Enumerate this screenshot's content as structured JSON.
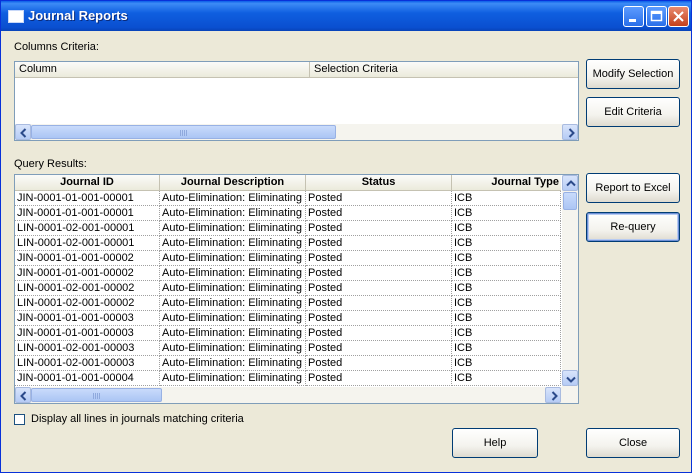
{
  "window": {
    "title": "Journal Reports"
  },
  "columns_criteria": {
    "label": "Columns Criteria:",
    "headers": [
      "Column",
      "Selection Criteria"
    ]
  },
  "query_results": {
    "label": "Query Results:",
    "headers": [
      "Journal ID",
      "Journal Description",
      "Status",
      "Journal Type"
    ],
    "rows": [
      [
        "JIN-0001-01-001-00001",
        "Auto-Elimination: Eliminating Tr",
        "Posted",
        "ICB"
      ],
      [
        "JIN-0001-01-001-00001",
        "Auto-Elimination: Eliminating Tr",
        "Posted",
        "ICB"
      ],
      [
        "LIN-0001-02-001-00001",
        "Auto-Elimination: Eliminating Tr",
        "Posted",
        "ICB"
      ],
      [
        "LIN-0001-02-001-00001",
        "Auto-Elimination: Eliminating Tr",
        "Posted",
        "ICB"
      ],
      [
        "JIN-0001-01-001-00002",
        "Auto-Elimination: Eliminating Tr",
        "Posted",
        "ICB"
      ],
      [
        "JIN-0001-01-001-00002",
        "Auto-Elimination: Eliminating Tr",
        "Posted",
        "ICB"
      ],
      [
        "LIN-0001-02-001-00002",
        "Auto-Elimination: Eliminating Tr",
        "Posted",
        "ICB"
      ],
      [
        "LIN-0001-02-001-00002",
        "Auto-Elimination: Eliminating Tr",
        "Posted",
        "ICB"
      ],
      [
        "JIN-0001-01-001-00003",
        "Auto-Elimination: Eliminating Tr",
        "Posted",
        "ICB"
      ],
      [
        "JIN-0001-01-001-00003",
        "Auto-Elimination: Eliminating Tr",
        "Posted",
        "ICB"
      ],
      [
        "LIN-0001-02-001-00003",
        "Auto-Elimination: Eliminating Tr",
        "Posted",
        "ICB"
      ],
      [
        "LIN-0001-02-001-00003",
        "Auto-Elimination: Eliminating Tr",
        "Posted",
        "ICB"
      ],
      [
        "JIN-0001-01-001-00004",
        "Auto-Elimination: Eliminating Tr",
        "Posted",
        "ICB"
      ]
    ]
  },
  "buttons": {
    "modify_selection": "Modify Selection",
    "edit_criteria": "Edit Criteria",
    "report_to_excel": "Report to Excel",
    "requery": "Re-query",
    "help": "Help",
    "close": "Close"
  },
  "checkbox": {
    "label": "Display all lines in journals matching criteria",
    "checked": false
  },
  "icons": {
    "title": "window-icon",
    "minimize": "minimize-icon",
    "maximize": "maximize-icon",
    "close": "close-icon",
    "scroll_left": "arrow-left-icon",
    "scroll_right": "arrow-right-icon",
    "scroll_up": "arrow-up-icon",
    "scroll_down": "arrow-down-icon"
  },
  "colors": {
    "titlebar": "#0a4fd0",
    "window_bg": "#ece9d8",
    "border": "#7f9db9"
  }
}
